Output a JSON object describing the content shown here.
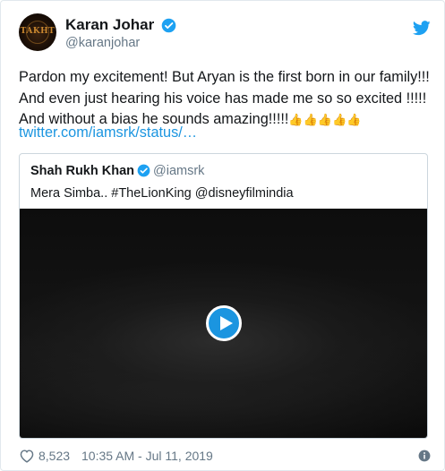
{
  "author": {
    "display_name": "Karan Johar",
    "handle": "@karanjohar",
    "avatar_text": "TAKHT"
  },
  "tweet": {
    "text": "Pardon my  excitement! But Aryan is the first born in our family!!!\nAnd even just hearing his voice has made me so so excited !!!!!\nAnd without a bias he sounds amazing!!!!!",
    "emoji": "👍👍👍👍👍",
    "link": "twitter.com/iamsrk/status/…"
  },
  "quoted": {
    "display_name": "Shah Rukh Khan",
    "handle": "@iamsrk",
    "text": "Mera Simba.. #TheLionKing @disneyfilmindia"
  },
  "footer": {
    "likes": "8,523",
    "timestamp": "10:35 AM - Jul 11, 2019"
  },
  "icons": {
    "verified": "verified-badge-icon",
    "brand": "twitter-bird-icon",
    "like": "heart-icon",
    "info": "info-icon",
    "play": "play-icon"
  },
  "colors": {
    "accent": "#1da1f2",
    "link": "#1b95e0",
    "secondary_text": "#657786"
  }
}
